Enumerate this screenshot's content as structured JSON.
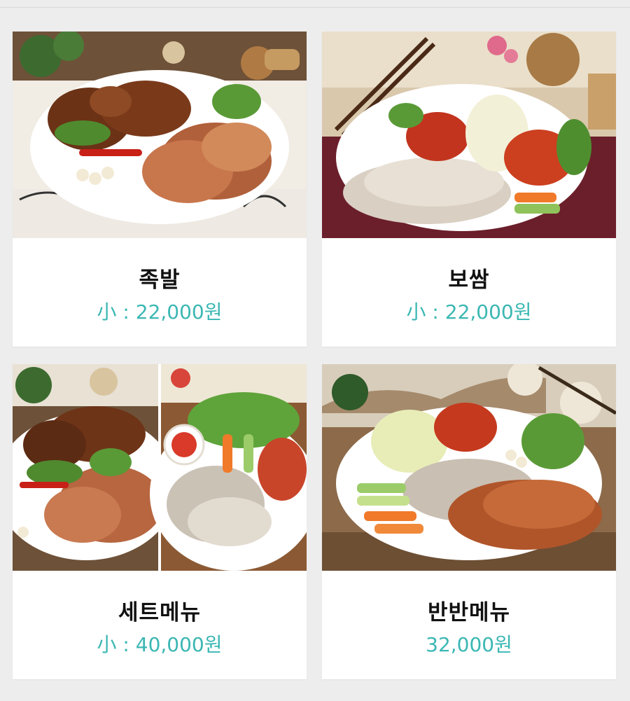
{
  "colors": {
    "background": "#ededed",
    "card": "#ffffff",
    "name_text": "#111111",
    "price_accent": "#3bb7b3"
  },
  "menu_items": [
    {
      "name": "족발",
      "price": "小 : 22,000원",
      "image": "jokbal-platter-photo"
    },
    {
      "name": "보쌈",
      "price": "小 : 22,000원",
      "image": "bossam-platter-photo"
    },
    {
      "name": "세트메뉴",
      "price": "小 : 40,000원",
      "image": "set-menu-platter-photo"
    },
    {
      "name": "반반메뉴",
      "price": "32,000원",
      "image": "half-half-platter-photo"
    }
  ]
}
